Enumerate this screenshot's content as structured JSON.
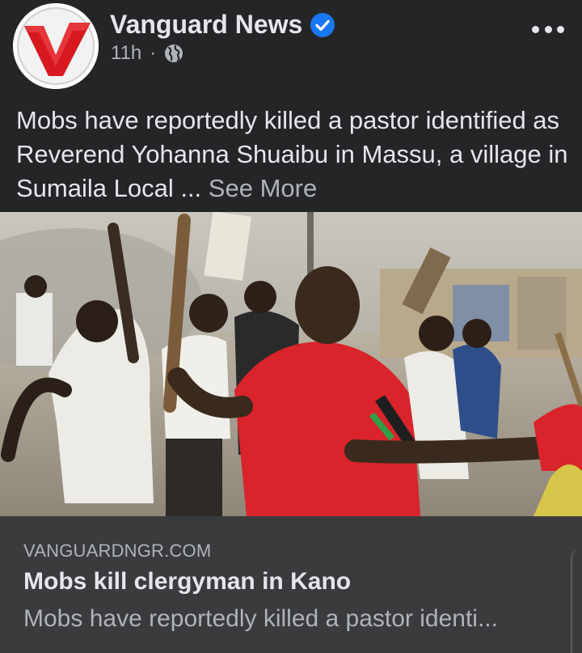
{
  "post": {
    "page_name": "Vanguard News",
    "time": "11h",
    "separator": "·",
    "audience_icon": "globe-icon",
    "verified_icon": "verified-badge-icon",
    "menu_icon": "more-options-icon",
    "text": "Mobs have reportedly killed a pastor identified as Reverend Yohanna Shuaibu in Massu, a village in Sumaila Local ... ",
    "see_more": "See More"
  },
  "link_preview": {
    "domain": "VANGUARDNGR.COM",
    "title": "Mobs kill clergyman in Kano",
    "description": "Mobs have reportedly killed a pastor identi..."
  },
  "colors": {
    "background": "#242526",
    "card": "#3a3b3c",
    "primary_text": "#e4e6eb",
    "secondary_text": "#b0b3b8",
    "verified": "#1877f2",
    "logo_red": "#d7191f"
  }
}
